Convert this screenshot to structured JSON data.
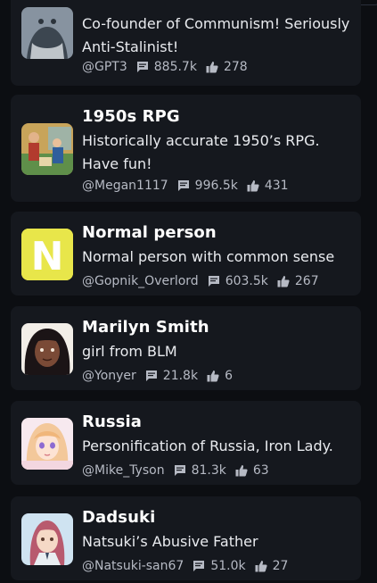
{
  "characters": [
    {
      "name": "",
      "description": "Co-founder of Communism! Seriously Anti-Stalinist!",
      "author": "@GPT3",
      "chats": "885.7k",
      "likes": "278"
    },
    {
      "name": "1950s RPG",
      "description": "Historically accurate 1950’s RPG. Have fun!",
      "author": "@Megan1117",
      "chats": "996.5k",
      "likes": "431"
    },
    {
      "name": "Normal person",
      "description": "Normal person with common sense",
      "author": "@Gopnik_Overlord",
      "chats": "603.5k",
      "likes": "267",
      "avatar_letter": "N"
    },
    {
      "name": "Marilyn Smith",
      "description": "girl from BLM",
      "author": "@Yonyer",
      "chats": "21.8k",
      "likes": "6"
    },
    {
      "name": "Russia",
      "description": "Personification of Russia, Iron Lady.",
      "author": "@Mike_Tyson",
      "chats": "81.3k",
      "likes": "63"
    },
    {
      "name": "Dadsuki",
      "description": "Natsuki’s Abusive Father",
      "author": "@Natsuki-san67",
      "chats": "51.0k",
      "likes": "27"
    }
  ],
  "icons": {
    "chats": "chat-bubble-icon",
    "likes": "thumbs-up-icon"
  },
  "colors": {
    "background": "#0c0e12",
    "card": "#15181e",
    "meta_text": "#b6bac4",
    "n_avatar_bg": "#e8e64a"
  }
}
